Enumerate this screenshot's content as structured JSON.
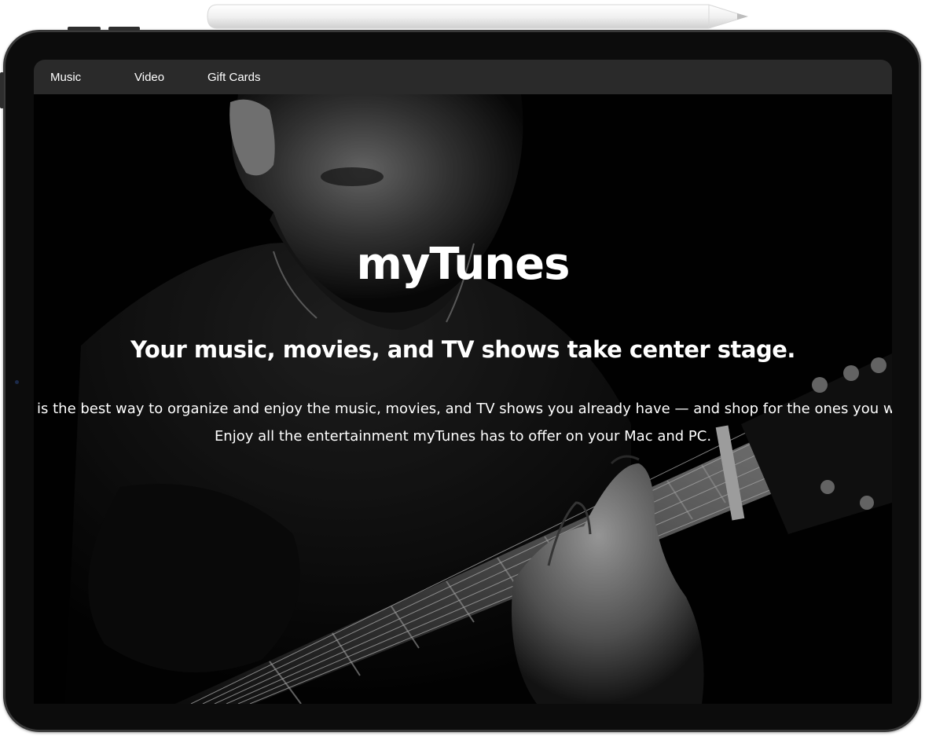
{
  "nav": {
    "items": [
      {
        "label": "Music"
      },
      {
        "label": "Video"
      },
      {
        "label": "Gift Cards"
      }
    ]
  },
  "hero": {
    "title": "myTunes",
    "subtitle": "Your music, movies, and TV shows take center stage.",
    "body_line1": "is the best way to organize and enjoy the music, movies, and TV shows you already have — and shop for the ones you want to buy.",
    "body_line2": "Enjoy all the entertainment myTunes has to offer on your Mac and PC."
  },
  "colors": {
    "navbar_bg": "#2a2a2a",
    "text": "#ffffff",
    "device_frame": "#0c0c0c",
    "device_bezel_edge": "#3a3a3a"
  },
  "icons": {
    "device": "tablet-icon",
    "stylus": "pencil-icon"
  }
}
